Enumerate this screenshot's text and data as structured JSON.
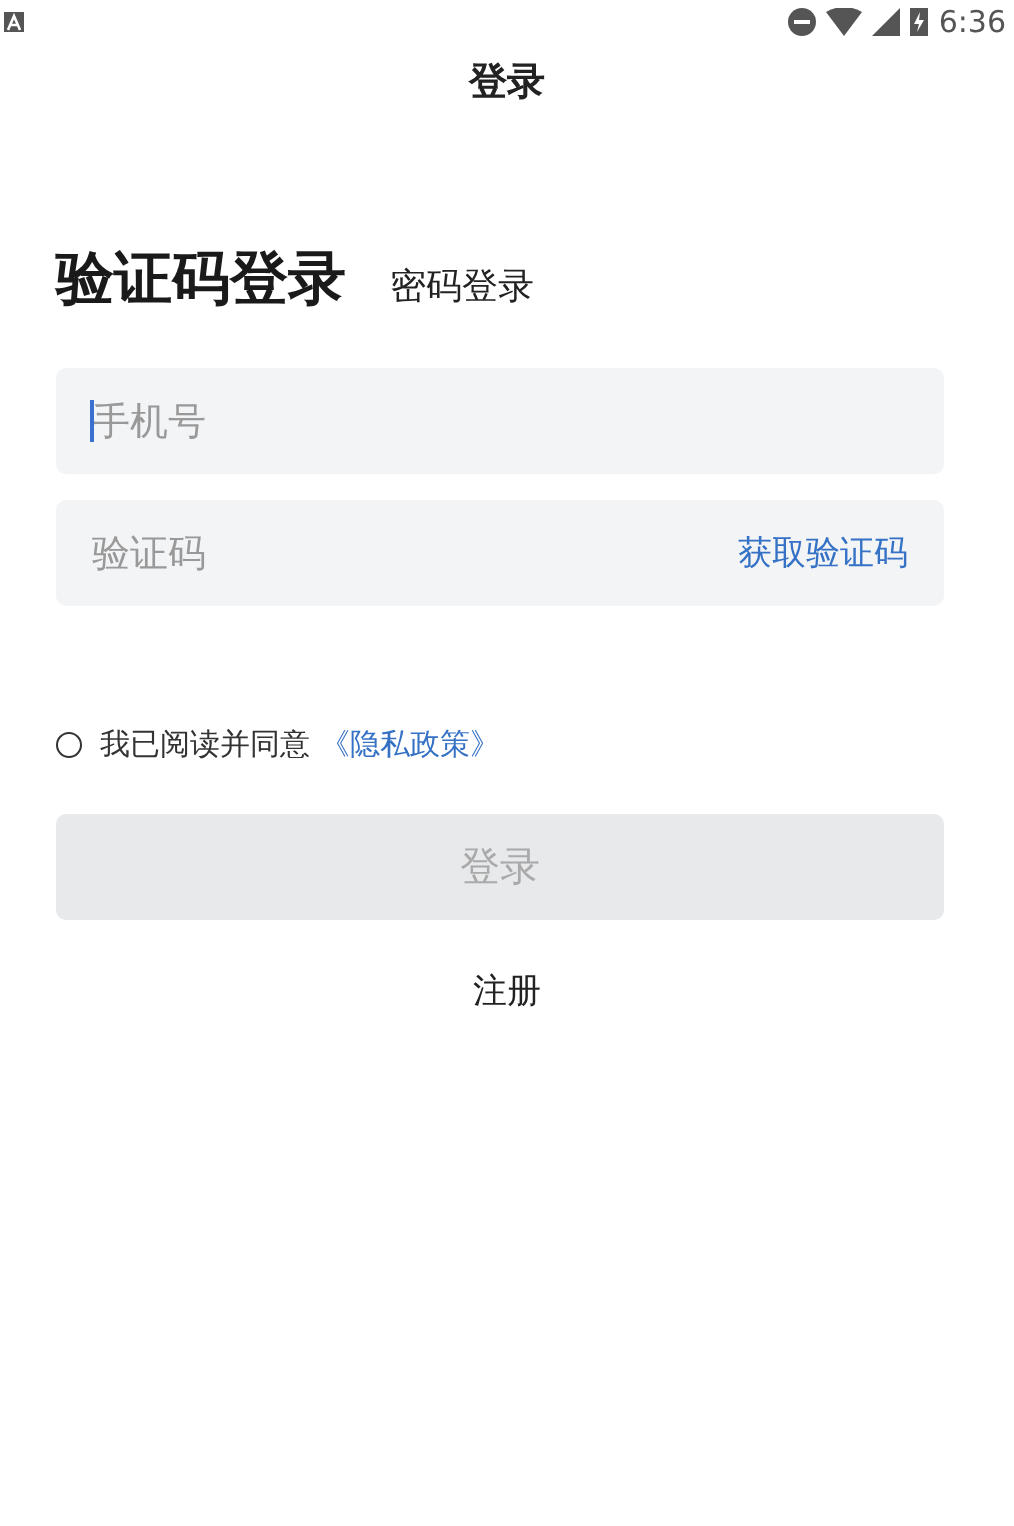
{
  "status_bar": {
    "time": "6:36"
  },
  "header": {
    "title": "登录"
  },
  "tabs": [
    {
      "label": "验证码登录",
      "selected": true
    },
    {
      "label": "密码登录",
      "selected": false
    }
  ],
  "fields": [
    {
      "placeholder": "手机号",
      "focused": true
    },
    {
      "placeholder": "验证码",
      "action": "获取验证码",
      "focused": false
    }
  ],
  "agreement": {
    "checked": false,
    "text": "我已阅读并同意",
    "link": "《隐私政策》"
  },
  "login_button": {
    "label": "登录",
    "disabled": true
  },
  "register_link": "注册"
}
